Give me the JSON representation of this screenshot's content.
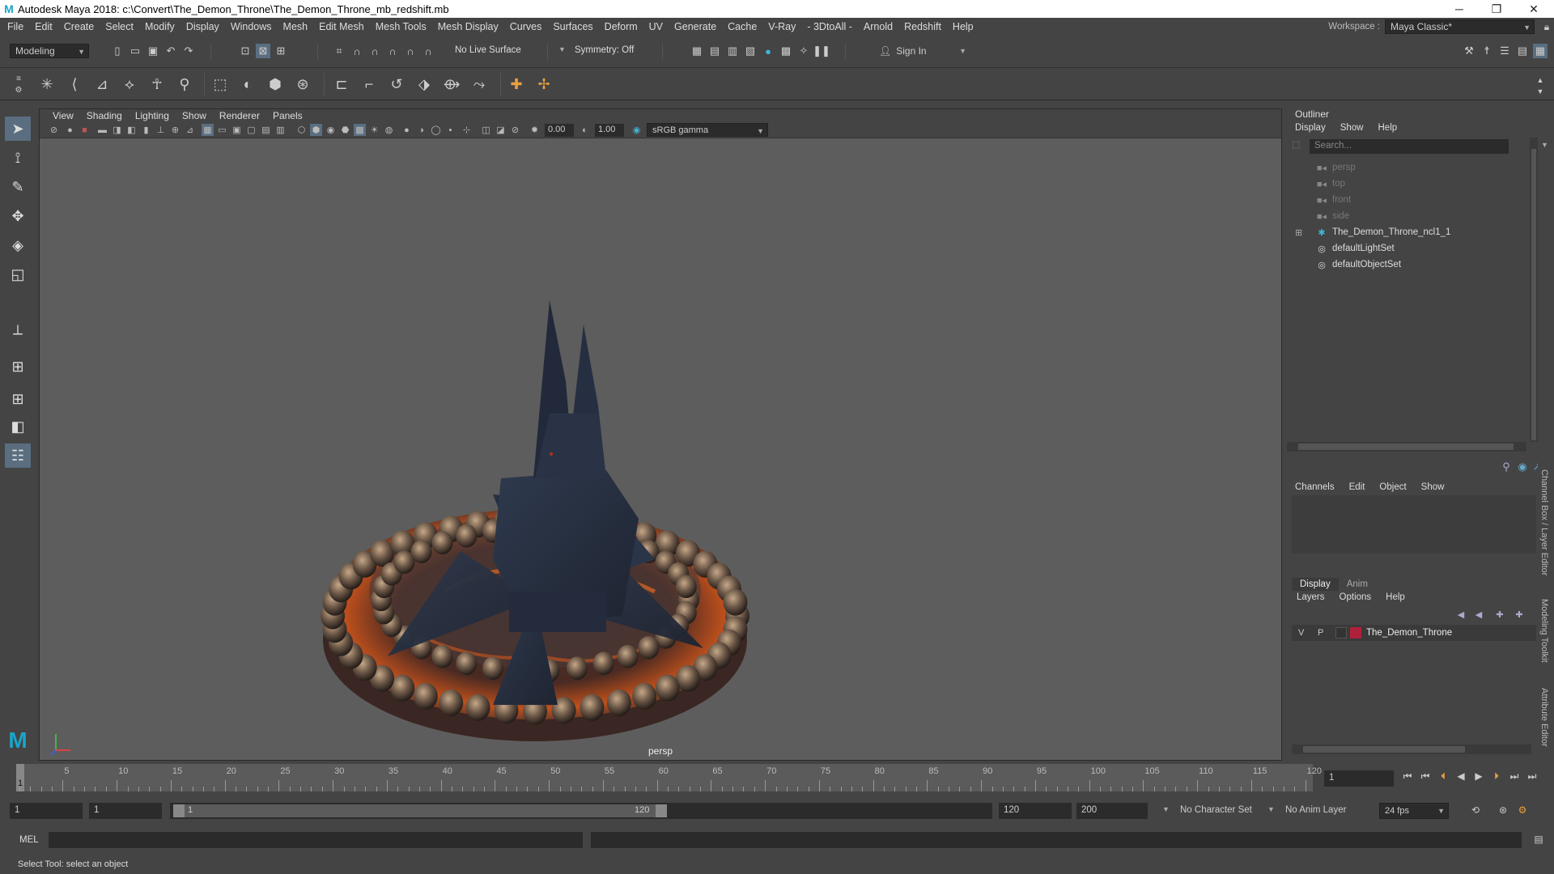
{
  "window": {
    "title": "Autodesk Maya 2018: c:\\Convert\\The_Demon_Throne\\The_Demon_Throne_mb_redshift.mb",
    "logo": "M",
    "minimize": "─",
    "maximize": "❐",
    "close": "✕"
  },
  "menubar": {
    "items": [
      "File",
      "Edit",
      "Create",
      "Select",
      "Modify",
      "Display",
      "Windows",
      "Mesh",
      "Edit Mesh",
      "Mesh Tools",
      "Mesh Display",
      "Curves",
      "Surfaces",
      "Deform",
      "UV",
      "Generate",
      "Cache",
      "V-Ray",
      "- 3DtoAll -",
      "Arnold",
      "Redshift",
      "Help"
    ],
    "workspace_label": "Workspace :",
    "workspace_value": "Maya Classic*"
  },
  "statusline": {
    "mode": "Modeling",
    "live_surface": "No Live Surface",
    "symmetry": "Symmetry: Off",
    "sign_in": "Sign In"
  },
  "viewport": {
    "menu": [
      "View",
      "Shading",
      "Lighting",
      "Show",
      "Renderer",
      "Panels"
    ],
    "exposure": "0.00",
    "gamma": "1.00",
    "color_space": "sRGB gamma",
    "camera": "persp"
  },
  "outliner": {
    "title": "Outliner",
    "menu": [
      "Display",
      "Show",
      "Help"
    ],
    "search_placeholder": "Search...",
    "items": [
      {
        "label": "persp",
        "icon": "camera-icon",
        "dim": true
      },
      {
        "label": "top",
        "icon": "camera-icon",
        "dim": true
      },
      {
        "label": "front",
        "icon": "camera-icon",
        "dim": true
      },
      {
        "label": "side",
        "icon": "camera-icon",
        "dim": true
      },
      {
        "label": "The_Demon_Throne_ncl1_1",
        "icon": "transform-icon",
        "dim": false,
        "expand": "⊞"
      },
      {
        "label": "defaultLightSet",
        "icon": "set-icon",
        "dim": false
      },
      {
        "label": "defaultObjectSet",
        "icon": "set-icon",
        "dim": false
      }
    ]
  },
  "channelbox": {
    "menu": [
      "Channels",
      "Edit",
      "Object",
      "Show"
    ]
  },
  "layereditor": {
    "tabs": [
      "Display",
      "Anim"
    ],
    "menu": [
      "Layers",
      "Options",
      "Help"
    ],
    "layer": {
      "v": "V",
      "p": "P",
      "name": "The_Demon_Throne",
      "color": "#b0203a"
    }
  },
  "sidetabs": [
    "Channel Box / Layer Editor",
    "Modeling Toolkit",
    "Attribute Editor"
  ],
  "timeline": {
    "labels": [
      "5",
      "10",
      "15",
      "20",
      "25",
      "30",
      "35",
      "40",
      "45",
      "50",
      "55",
      "60",
      "65",
      "70",
      "75",
      "80",
      "85",
      "90",
      "95",
      "100",
      "105",
      "110",
      "115",
      "120"
    ],
    "current_marker": "1",
    "current_frame": "1"
  },
  "range": {
    "start": "1",
    "inner_start": "1",
    "slider_start": "1",
    "slider_end": "120",
    "end": "120",
    "anim_end": "200",
    "character_set": "No Character Set",
    "anim_layer": "No Anim Layer",
    "fps": "24 fps"
  },
  "cmdline": {
    "label": "MEL"
  },
  "helpline": {
    "text": "Select Tool: select an object"
  },
  "colors": {
    "accent": "#1aa5c8",
    "layer_color": "#b0203a"
  }
}
